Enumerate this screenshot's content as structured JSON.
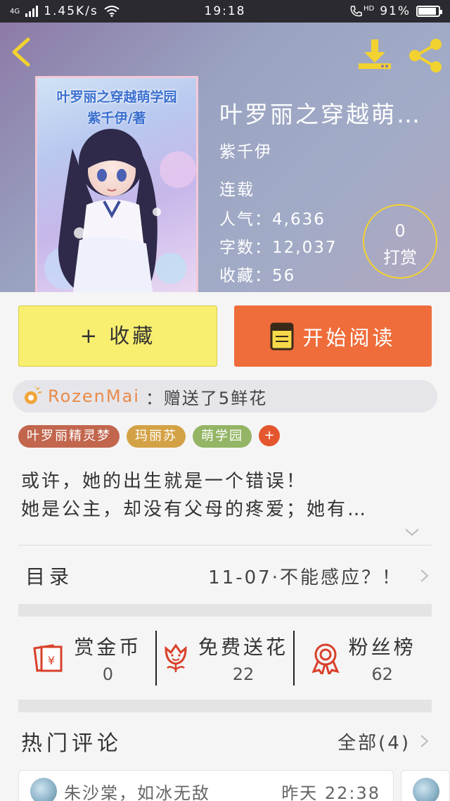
{
  "status_bar": {
    "network": "4G",
    "speed": "1.45K/s",
    "time": "19:18",
    "hd": "HD",
    "battery": "91%",
    "battery_level": 0.91
  },
  "book": {
    "title": "叶罗丽之穿越萌…",
    "cover_title": "叶罗丽之穿越萌学园",
    "cover_author": "紫千伊/著",
    "author": "紫千伊",
    "status": "连载",
    "popularity": "人气：4,636",
    "word_count": "字数：12,037",
    "favorites": "收藏：56",
    "tip_count": "0",
    "tip_label": "打赏"
  },
  "actions": {
    "collect_label": "+ 收藏",
    "read_label": "开始阅读"
  },
  "gift": {
    "user": "RozenMai",
    "text": "：赠送了5鲜花"
  },
  "tags": [
    {
      "label": "叶罗丽精灵梦",
      "color": "#c2664e"
    },
    {
      "label": "玛丽苏",
      "color": "#d4a246"
    },
    {
      "label": "萌学园",
      "color": "#94b565"
    }
  ],
  "tag_more": "+",
  "description": {
    "line1": "或许，她的出生就是一个错误！",
    "line2": "她是公主，却没有父母的疼爱；她有…"
  },
  "toc": {
    "label": "目录",
    "latest": "11-07·不能感应？！"
  },
  "stats": [
    {
      "label": "赏金币",
      "value": "0",
      "icon": "red-envelope-icon"
    },
    {
      "label": "免费送花",
      "value": "22",
      "icon": "flower-icon"
    },
    {
      "label": "粉丝榜",
      "value": "62",
      "icon": "ribbon-badge-icon"
    }
  ],
  "comments": {
    "title": "热门评论",
    "all_label": "全部(4)",
    "first": {
      "user": "朱沙棠，如冰无敌",
      "time": "昨天 22:38"
    }
  },
  "colors": {
    "accent_yellow": "#f2d230",
    "collect_bg": "#f8ee70",
    "read_bg": "#ef6d3b",
    "gift_user": "#e88a4a",
    "stat_icon_red": "#d9402a"
  }
}
